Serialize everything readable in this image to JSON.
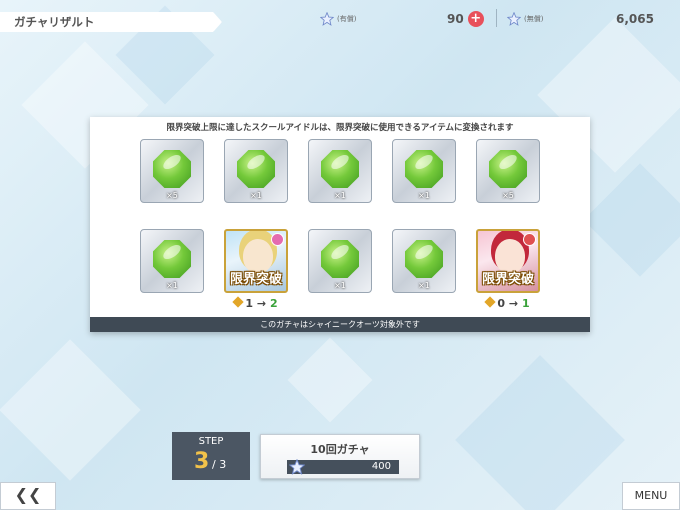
{
  "header": {
    "title": "ガチャリザルト"
  },
  "currency": {
    "paid_label": "(有償)",
    "paid_amount": "90",
    "free_label": "(無償)",
    "free_amount": "6,065"
  },
  "panel": {
    "message": "限界突破上限に達したスクールアイドルは、限界突破に使用できるアイテムに変換されます",
    "footer": "このガチャはシャイニークオーツ対象外です",
    "row1": [
      {
        "qty": "×5"
      },
      {
        "qty": "×1"
      },
      {
        "qty": "×1"
      },
      {
        "qty": "×1"
      },
      {
        "qty": "×5"
      }
    ],
    "row2": {
      "item1_qty": "×1",
      "card1": {
        "label": "限界突破",
        "from": "1",
        "to": "2"
      },
      "item3_qty": "×1",
      "item4_qty": "×1",
      "card2": {
        "label": "限界突破",
        "from": "0",
        "to": "1"
      }
    }
  },
  "step": {
    "label": "STEP",
    "current": "3",
    "total": "/ 3"
  },
  "gacha_button": {
    "title": "10回ガチャ",
    "cost": "400"
  },
  "nav": {
    "back": "❮❮",
    "menu": "MENU"
  }
}
